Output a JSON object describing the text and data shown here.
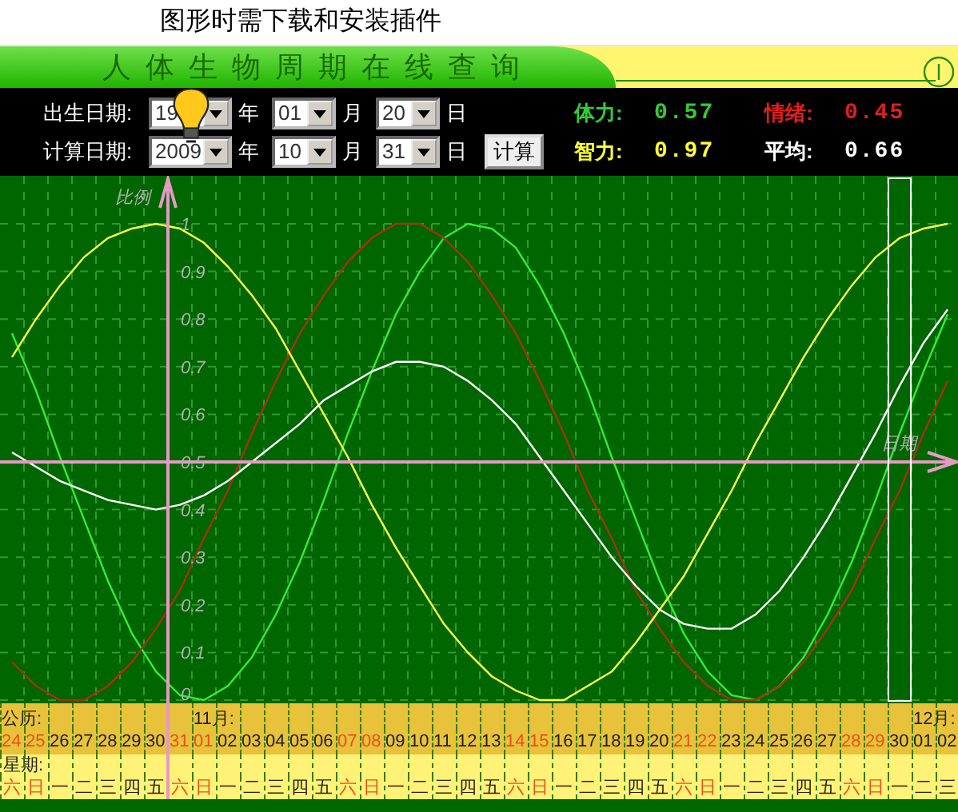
{
  "notice": {
    "text": "图形时需下载和安装插件"
  },
  "title": "人体生物周期在线查询",
  "date_rows": [
    {
      "label": "出生日期:",
      "year": "19",
      "year_unit": "年",
      "month": "01",
      "month_unit": "月",
      "day": "20",
      "day_unit": "日"
    },
    {
      "label": "计算日期:",
      "year": "2009",
      "year_unit": "年",
      "month": "10",
      "month_unit": "月",
      "day": "31",
      "day_unit": "日"
    }
  ],
  "calc_button": "计算",
  "readings": [
    {
      "label": "体力:",
      "value": "0.57",
      "color": "#33cc33"
    },
    {
      "label": "情绪:",
      "value": "0.45",
      "color": "#dd1f1f"
    },
    {
      "label": "智力:",
      "value": "0.97",
      "color": "#ffff33"
    },
    {
      "label": "平均:",
      "value": "0.66",
      "color": "#ffffff"
    }
  ],
  "chart_data": {
    "type": "line",
    "ylabel": "比例",
    "xlabel": "日期",
    "ylim": [
      0,
      1
    ],
    "grid": true,
    "ref_lines": [
      {
        "axis": "y",
        "value": 0.5
      }
    ],
    "yticks": [
      0,
      0.1,
      0.2,
      0.3,
      0.4,
      0.5,
      0.6,
      0.7,
      0.8,
      0.9,
      1
    ],
    "categories": [
      "24",
      "25",
      "26",
      "27",
      "28",
      "29",
      "30",
      "31",
      "01",
      "02",
      "03",
      "04",
      "05",
      "06",
      "07",
      "08",
      "09",
      "10",
      "11",
      "12",
      "13",
      "14",
      "15",
      "16",
      "17",
      "18",
      "19",
      "20",
      "21",
      "22",
      "23",
      "24",
      "25",
      "26",
      "27",
      "28",
      "29",
      "30",
      "01",
      "02"
    ],
    "series": [
      {
        "color": "#33ee33",
        "values": [
          0.77,
          0.65,
          0.51,
          0.38,
          0.25,
          0.14,
          0.06,
          0.01,
          0,
          0.03,
          0.09,
          0.18,
          0.29,
          0.42,
          0.56,
          0.69,
          0.81,
          0.9,
          0.97,
          1,
          0.99,
          0.95,
          0.87,
          0.77,
          0.65,
          0.51,
          0.38,
          0.25,
          0.14,
          0.06,
          0.01,
          0,
          0.03,
          0.09,
          0.18,
          0.29,
          0.42,
          0.56,
          0.69,
          0.81
        ]
      },
      {
        "color": "#a3301a",
        "values": [
          0.08,
          0.03,
          0,
          0,
          0.03,
          0.08,
          0.15,
          0.23,
          0.34,
          0.44,
          0.56,
          0.67,
          0.77,
          0.85,
          0.92,
          0.97,
          1,
          1,
          0.97,
          0.92,
          0.85,
          0.77,
          0.67,
          0.56,
          0.44,
          0.34,
          0.23,
          0.15,
          0.08,
          0.03,
          0,
          0,
          0.03,
          0.08,
          0.15,
          0.23,
          0.34,
          0.44,
          0.56,
          0.67
        ]
      },
      {
        "color": "#ffff44",
        "values": [
          0.72,
          0.8,
          0.87,
          0.93,
          0.97,
          0.99,
          1,
          0.99,
          0.96,
          0.91,
          0.85,
          0.78,
          0.69,
          0.6,
          0.51,
          0.41,
          0.32,
          0.24,
          0.16,
          0.1,
          0.05,
          0.02,
          0,
          0,
          0.03,
          0.06,
          0.12,
          0.19,
          0.26,
          0.35,
          0.44,
          0.54,
          0.63,
          0.72,
          0.8,
          0.87,
          0.93,
          0.97,
          0.99,
          1
        ]
      },
      {
        "color": "#ffffff",
        "values": [
          0.52,
          0.49,
          0.46,
          0.44,
          0.42,
          0.41,
          0.4,
          0.41,
          0.43,
          0.46,
          0.5,
          0.54,
          0.58,
          0.63,
          0.66,
          0.69,
          0.71,
          0.71,
          0.7,
          0.67,
          0.63,
          0.58,
          0.51,
          0.44,
          0.37,
          0.3,
          0.24,
          0.19,
          0.16,
          0.15,
          0.15,
          0.18,
          0.23,
          0.3,
          0.38,
          0.47,
          0.56,
          0.66,
          0.75,
          0.82
        ]
      }
    ]
  },
  "calendar": {
    "date_row_label": "公历:",
    "weekday_row_label": "星期:",
    "days": [
      {
        "weekday": "六",
        "weekend": true,
        "selected": false
      },
      {
        "weekday": "日",
        "weekend": true,
        "selected": false
      },
      {
        "weekday": "一",
        "weekend": false,
        "selected": false
      },
      {
        "weekday": "二",
        "weekend": false,
        "selected": false
      },
      {
        "weekday": "三",
        "weekend": false,
        "selected": false
      },
      {
        "weekday": "四",
        "weekend": false,
        "selected": false
      },
      {
        "weekday": "五",
        "weekend": false,
        "selected": false
      },
      {
        "weekday": "六",
        "weekend": true,
        "selected": false
      },
      {
        "weekday": "日",
        "weekend": true,
        "selected": false,
        "month": "11月:"
      },
      {
        "weekday": "一",
        "weekend": false,
        "selected": false
      },
      {
        "weekday": "二",
        "weekend": false,
        "selected": false
      },
      {
        "weekday": "三",
        "weekend": false,
        "selected": false
      },
      {
        "weekday": "四",
        "weekend": false,
        "selected": false
      },
      {
        "weekday": "五",
        "weekend": false,
        "selected": false
      },
      {
        "weekday": "六",
        "weekend": true,
        "selected": false
      },
      {
        "weekday": "日",
        "weekend": true,
        "selected": false
      },
      {
        "weekday": "一",
        "weekend": false,
        "selected": false
      },
      {
        "weekday": "二",
        "weekend": false,
        "selected": false
      },
      {
        "weekday": "三",
        "weekend": false,
        "selected": false
      },
      {
        "weekday": "四",
        "weekend": false,
        "selected": false
      },
      {
        "weekday": "五",
        "weekend": false,
        "selected": false
      },
      {
        "weekday": "六",
        "weekend": true,
        "selected": false
      },
      {
        "weekday": "日",
        "weekend": true,
        "selected": false
      },
      {
        "weekday": "一",
        "weekend": false,
        "selected": false
      },
      {
        "weekday": "二",
        "weekend": false,
        "selected": false
      },
      {
        "weekday": "三",
        "weekend": false,
        "selected": false
      },
      {
        "weekday": "四",
        "weekend": false,
        "selected": false
      },
      {
        "weekday": "五",
        "weekend": false,
        "selected": false
      },
      {
        "weekday": "六",
        "weekend": true,
        "selected": false
      },
      {
        "weekday": "日",
        "weekend": true,
        "selected": false
      },
      {
        "weekday": "一",
        "weekend": false,
        "selected": false
      },
      {
        "weekday": "二",
        "weekend": false,
        "selected": false
      },
      {
        "weekday": "三",
        "weekend": false,
        "selected": false
      },
      {
        "weekday": "四",
        "weekend": false,
        "selected": false
      },
      {
        "weekday": "五",
        "weekend": false,
        "selected": false
      },
      {
        "weekday": "六",
        "weekend": true,
        "selected": false
      },
      {
        "weekday": "日",
        "weekend": true,
        "selected": false
      },
      {
        "weekday": "一",
        "weekend": false,
        "selected": true
      },
      {
        "weekday": "二",
        "weekend": false,
        "selected": false,
        "month": "12月:"
      },
      {
        "weekday": "三",
        "weekend": false,
        "selected": false
      }
    ]
  }
}
